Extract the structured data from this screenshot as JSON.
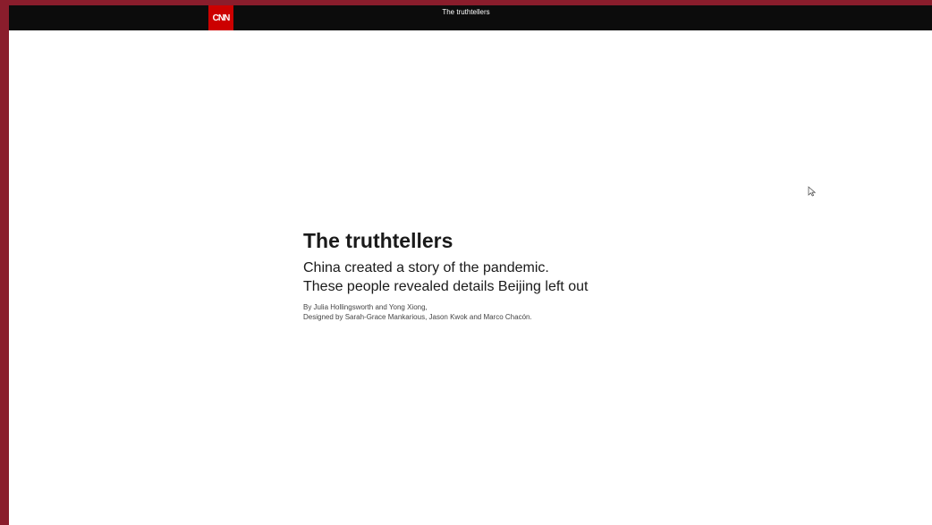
{
  "header": {
    "logo_text": "CNN",
    "title": "The truthtellers",
    "logo_color": "#cc0000",
    "bar_color": "#0c0c0c"
  },
  "article": {
    "headline": "The truthtellers",
    "subheadline_line1": "China created a story of the pandemic.",
    "subheadline_line2": "These people revealed details Beijing left out",
    "byline": "By Julia Hollingsworth and Yong Xiong,",
    "design_credit": "Designed by Sarah-Grace Mankarious, Jason Kwok and Marco Chacón."
  },
  "frame_color": "#8a1d2c",
  "cursor_icon": "mouse-pointer-icon"
}
